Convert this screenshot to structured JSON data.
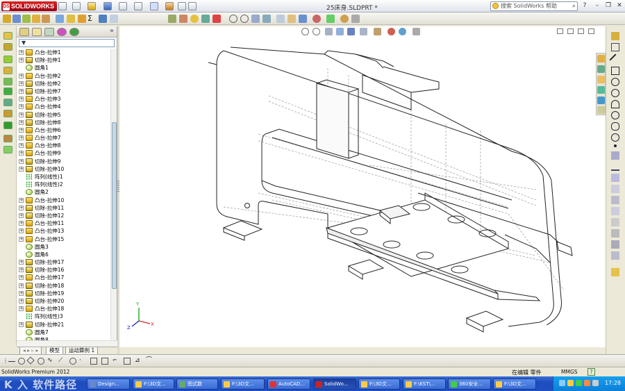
{
  "app": {
    "logo_text": "SOLIDWORKS",
    "document_title": "25床身.SLDPRT *",
    "help_search_placeholder": "搜索 SolidWorks 帮助"
  },
  "feature_tree": {
    "items": [
      {
        "label": "凸台-拉伸1",
        "icon": "boss-extrude-icon"
      },
      {
        "label": "切除-拉伸1",
        "icon": "cut-extrude-icon"
      },
      {
        "label": "圆角1",
        "icon": "fillet-icon"
      },
      {
        "label": "凸台-拉伸2",
        "icon": "boss-extrude-icon"
      },
      {
        "label": "切除-拉伸2",
        "icon": "cut-extrude-icon"
      },
      {
        "label": "切除-拉伸7",
        "icon": "cut-extrude-icon"
      },
      {
        "label": "凸台-拉伸3",
        "icon": "boss-extrude-icon"
      },
      {
        "label": "凸台-拉伸4",
        "icon": "boss-extrude-icon"
      },
      {
        "label": "切除-拉伸5",
        "icon": "cut-extrude-icon"
      },
      {
        "label": "切除-拉伸8",
        "icon": "cut-extrude-icon"
      },
      {
        "label": "凸台-拉伸6",
        "icon": "boss-extrude-icon"
      },
      {
        "label": "凸台-拉伸7",
        "icon": "boss-extrude-icon"
      },
      {
        "label": "凸台-拉伸8",
        "icon": "boss-extrude-icon"
      },
      {
        "label": "凸台-拉伸9",
        "icon": "boss-extrude-icon"
      },
      {
        "label": "切除-拉伸9",
        "icon": "cut-extrude-icon"
      },
      {
        "label": "切除-拉伸10",
        "icon": "cut-extrude-icon"
      },
      {
        "label": "阵列(线性)1",
        "icon": "linear-pattern-icon"
      },
      {
        "label": "阵列(线性)2",
        "icon": "linear-pattern-icon"
      },
      {
        "label": "圆角2",
        "icon": "fillet-icon"
      },
      {
        "label": "凸台-拉伸10",
        "icon": "boss-extrude-icon"
      },
      {
        "label": "切除-拉伸11",
        "icon": "cut-extrude-icon"
      },
      {
        "label": "切除-拉伸12",
        "icon": "cut-extrude-icon"
      },
      {
        "label": "凸台-拉伸11",
        "icon": "boss-extrude-icon"
      },
      {
        "label": "凸台-拉伸13",
        "icon": "boss-extrude-icon"
      },
      {
        "label": "凸台-拉伸15",
        "icon": "boss-extrude-icon"
      },
      {
        "label": "圆角3",
        "icon": "fillet-icon"
      },
      {
        "label": "圆角6",
        "icon": "fillet-icon"
      },
      {
        "label": "切除-拉伸17",
        "icon": "cut-extrude-icon"
      },
      {
        "label": "切除-拉伸16",
        "icon": "cut-extrude-icon"
      },
      {
        "label": "凸台-拉伸17",
        "icon": "boss-extrude-icon"
      },
      {
        "label": "切除-拉伸18",
        "icon": "cut-extrude-icon"
      },
      {
        "label": "切除-拉伸19",
        "icon": "cut-extrude-icon"
      },
      {
        "label": "切除-拉伸20",
        "icon": "cut-extrude-icon"
      },
      {
        "label": "凸台-拉伸18",
        "icon": "boss-extrude-icon"
      },
      {
        "label": "阵列(线性)3",
        "icon": "linear-pattern-icon"
      },
      {
        "label": "切除-拉伸21",
        "icon": "cut-extrude-icon"
      },
      {
        "label": "圆角7",
        "icon": "fillet-icon"
      },
      {
        "label": "圆角8",
        "icon": "fillet-icon"
      }
    ]
  },
  "bottom_tabs": {
    "model": "模型",
    "motion": "运动算例 1"
  },
  "status": {
    "product": "SolidWorks Premium 2012",
    "editing": "在编辑 零件",
    "units": "MMGS",
    "help": "?"
  },
  "taskbar": {
    "watermark": "K 入 软件路径",
    "tasks": [
      "Design...",
      "F:\\3D文...",
      "图式数",
      "F:\\3D文...",
      "AutoCAD...",
      "SolidWo...",
      "F:\\3D文...",
      "F:\\KST\\...",
      "360安全...",
      "F:\\3D文..."
    ],
    "clock": "17:28"
  },
  "colors": {
    "solidworks_red": "#cc1111",
    "taskbar_blue": "#245edb",
    "tree_selection": "#316ac5"
  }
}
